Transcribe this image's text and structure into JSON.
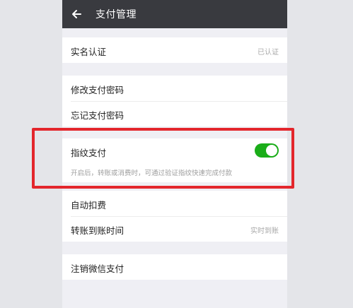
{
  "header": {
    "title": "支付管理",
    "back_icon": "back-arrow-icon"
  },
  "sections": {
    "identity": {
      "label": "实名认证",
      "value": "已认证"
    },
    "password": {
      "change_label": "修改支付密码",
      "forgot_label": "忘记支付密码"
    },
    "fingerprint": {
      "label": "指纹支付",
      "enabled": true,
      "description": "开启后，转账或消费时，可通过验证指纹快速完成付款"
    },
    "deduction": {
      "auto_label": "自动扣费",
      "transfer_label": "转账到账时间",
      "transfer_value": "实时到账"
    },
    "logout": {
      "label": "注销微信支付"
    }
  },
  "colors": {
    "topbar": "#393a3f",
    "toggle_on": "#1aad19",
    "highlight": "#e3262c",
    "background": "#efeff4"
  }
}
